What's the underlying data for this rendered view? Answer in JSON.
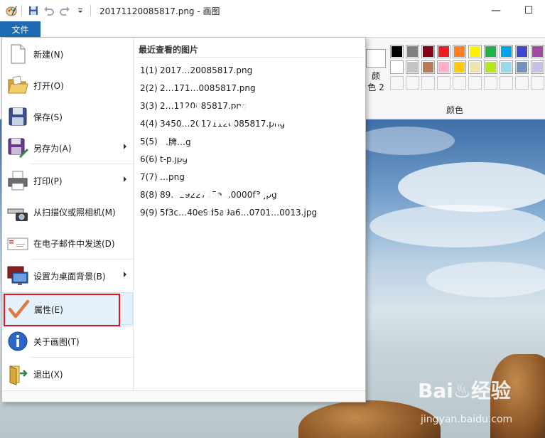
{
  "window": {
    "title": "20171120085817.png - 画图",
    "minimize": "—",
    "maximize": "☐"
  },
  "ribbon": {
    "file_tab": "文件",
    "color2_label": "颜\n色 2",
    "colors_group_label": "颜色",
    "palette_row1": [
      "#000000",
      "#7f7f7f",
      "#880015",
      "#ed1c24",
      "#ff7f27",
      "#fff200",
      "#22b14c",
      "#00a2e8",
      "#3f48cc",
      "#a349a4"
    ],
    "palette_row2": [
      "#ffffff",
      "#c3c3c3",
      "#b97a57",
      "#ffaec9",
      "#ffc90e",
      "#efe4b0",
      "#b5e61d",
      "#99d9ea",
      "#7092be",
      "#c8bfe7"
    ]
  },
  "file_menu": {
    "items": [
      {
        "label": "新建(N)",
        "icon": "new-file-icon",
        "submenu": false
      },
      {
        "label": "打开(O)",
        "icon": "open-folder-icon",
        "submenu": false
      },
      {
        "label": "保存(S)",
        "icon": "save-disk-icon",
        "submenu": false
      },
      {
        "label": "另存为(A)",
        "icon": "save-as-icon",
        "submenu": true
      },
      {
        "label": "打印(P)",
        "icon": "printer-icon",
        "submenu": true
      },
      {
        "label": "从扫描仪或照相机(M)",
        "icon": "scanner-camera-icon",
        "submenu": false
      },
      {
        "label": "在电子邮件中发送(D)",
        "icon": "email-icon",
        "submenu": false
      },
      {
        "label": "设置为桌面背景(B)",
        "icon": "desktop-background-icon",
        "submenu": true
      },
      {
        "label": "属性(E)",
        "icon": "checkmark-icon",
        "submenu": false
      },
      {
        "label": "关于画图(T)",
        "icon": "info-icon",
        "submenu": false
      },
      {
        "label": "退出(X)",
        "icon": "exit-icon",
        "submenu": false
      }
    ],
    "recent_title": "最近查看的图片",
    "recent_items": [
      {
        "num": "1(1)",
        "name": "2017…20085817.png"
      },
      {
        "num": "2(2)",
        "name": "2…171…0085817.png"
      },
      {
        "num": "3(3)",
        "name": "2…1120085817.png"
      },
      {
        "num": "4(4)",
        "name": "3450…20171120085817.png"
      },
      {
        "num": "5(5)",
        "name": "…牌…g"
      },
      {
        "num": "6(6)",
        "name": "t-p.jpg"
      },
      {
        "num": "7(7)",
        "name": "…png"
      },
      {
        "num": "8(8)",
        "name": "89…29227a5a…0000f3.jpg"
      },
      {
        "num": "9(9)",
        "name": "5f3c…40e9d5a9a6…0701…0013.jpg"
      }
    ]
  },
  "watermark": {
    "brand": "Bai♨经验",
    "url": "jingyan.baidu.com"
  }
}
